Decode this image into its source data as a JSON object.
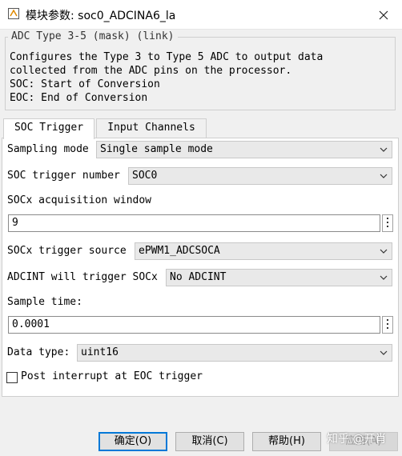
{
  "window": {
    "title": "模块参数: soc0_ADCINA6_la",
    "close_icon": "close-icon"
  },
  "mask": {
    "legend": "ADC Type 3-5 (mask) (link)",
    "description": "Configures the Type 3 to Type 5 ADC to output data\ncollected from the ADC pins on the processor.\nSOC: Start of Conversion\nEOC: End of Conversion"
  },
  "tabs": [
    {
      "label": "SOC Trigger",
      "active": true
    },
    {
      "label": "Input Channels",
      "active": false
    }
  ],
  "params": {
    "sampling_mode": {
      "label": "Sampling mode",
      "value": "Single sample mode"
    },
    "soc_trigger_number": {
      "label": "SOC trigger number",
      "value": "SOC0"
    },
    "acq_window": {
      "label": "SOCx acquisition window",
      "value": "9"
    },
    "trigger_source": {
      "label": "SOCx trigger source",
      "value": "ePWM1_ADCSOCA"
    },
    "adcint_trigger": {
      "label": "ADCINT will trigger SOCx",
      "value": "No ADCINT"
    },
    "sample_time": {
      "label": "Sample time:",
      "value": "0.0001"
    },
    "data_type": {
      "label": "Data type:",
      "value": "uint16"
    },
    "post_interrupt": {
      "label": "Post interrupt at EOC trigger",
      "checked": false
    }
  },
  "buttons": {
    "ok": "确定(O)",
    "cancel": "取消(C)",
    "help": "帮助(H)",
    "apply": "应用(A)"
  },
  "watermark": "知乎 @开肖",
  "colors": {
    "window_bg": "#f0f0f0",
    "panel_bg": "#ffffff",
    "default_button_border": "#0078d7"
  }
}
